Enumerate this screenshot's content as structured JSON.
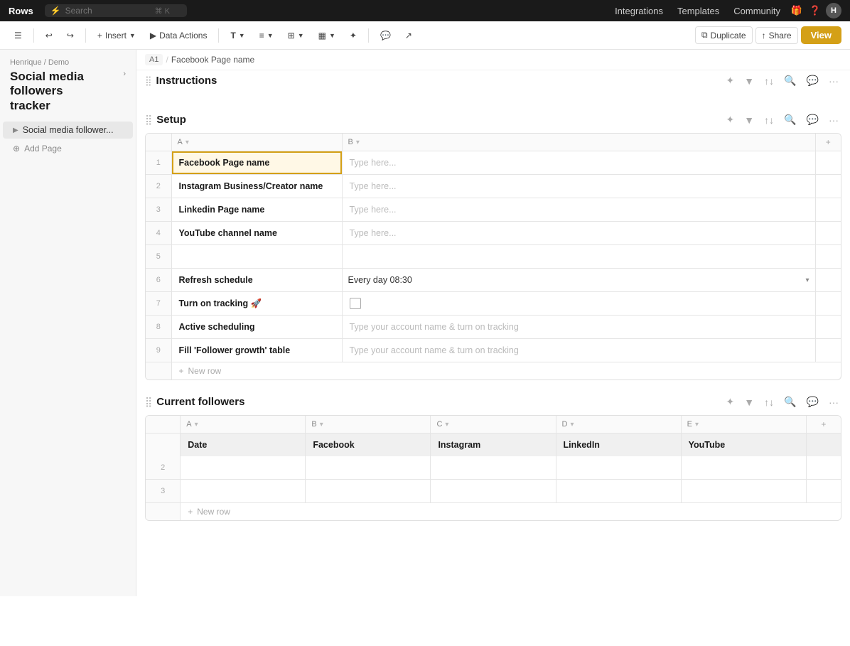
{
  "app": {
    "logo": "Rows",
    "search_placeholder": "Search",
    "search_kbd": "⌘ K"
  },
  "top_nav": {
    "integrations": "Integrations",
    "templates": "Templates",
    "community": "Community",
    "avatar_initials": "H"
  },
  "toolbar": {
    "sidebar_toggle": "☰",
    "undo": "↩",
    "redo": "↪",
    "insert": "Insert",
    "data_actions": "Data Actions",
    "text_format": "T",
    "align": "≡",
    "grid": "⊞",
    "chart": "📊",
    "brush": "✦",
    "comment": "💬",
    "stats": "📈",
    "duplicate": "Duplicate",
    "share": "Share",
    "view": "View"
  },
  "sidebar": {
    "breadcrumb_part1": "Henrique",
    "breadcrumb_sep": "/",
    "breadcrumb_part2": "Demo",
    "title_line1": "Social media",
    "title_line2": "followers",
    "title_line3": "tracker",
    "page_item": "Social media follower...",
    "add_page": "Add Page"
  },
  "breadcrumb_bar": {
    "cell": "A1",
    "sep": "/",
    "path": "Facebook Page name"
  },
  "instructions_section": {
    "title": "Instructions",
    "icons": [
      "✦",
      "▼",
      "↑↓",
      "🔍",
      "💬",
      "···"
    ]
  },
  "setup_section": {
    "title": "Setup",
    "icons": [
      "✦",
      "▼",
      "↑↓",
      "🔍",
      "💬",
      "···"
    ],
    "col_a_header": "A",
    "col_b_header": "B",
    "rows": [
      {
        "num": "1",
        "col_a": "Facebook Page name",
        "col_b": "",
        "col_b_placeholder": "Type here...",
        "type": "input",
        "selected": true
      },
      {
        "num": "2",
        "col_a": "Instagram Business/Creator name",
        "col_b": "",
        "col_b_placeholder": "Type here...",
        "type": "input"
      },
      {
        "num": "3",
        "col_a": "Linkedin Page name",
        "col_b": "",
        "col_b_placeholder": "Type here...",
        "type": "input"
      },
      {
        "num": "4",
        "col_a": "YouTube channel name",
        "col_b": "",
        "col_b_placeholder": "Type here...",
        "type": "input"
      },
      {
        "num": "5",
        "col_a": "",
        "col_b": "",
        "type": "empty"
      },
      {
        "num": "6",
        "col_a": "Refresh schedule",
        "col_b": "Every day 08:30",
        "type": "dropdown"
      },
      {
        "num": "7",
        "col_a": "Turn on tracking 🚀",
        "col_b": "",
        "type": "checkbox"
      },
      {
        "num": "8",
        "col_a": "Active scheduling",
        "col_b": "Type your account name & turn on tracking",
        "type": "text"
      },
      {
        "num": "9",
        "col_a": "Fill 'Follower growth' table",
        "col_b": "Type your account name & turn on tracking",
        "type": "text"
      }
    ],
    "new_row": "+ New row"
  },
  "current_followers_section": {
    "title": "Current followers",
    "icons": [
      "✦",
      "▼",
      "↑↓",
      "🔍",
      "💬",
      "···"
    ],
    "columns": [
      {
        "letter": "A",
        "name": "Date"
      },
      {
        "letter": "B",
        "name": "Facebook"
      },
      {
        "letter": "C",
        "name": "Instagram"
      },
      {
        "letter": "D",
        "name": "LinkedIn"
      },
      {
        "letter": "E",
        "name": "YouTube"
      }
    ],
    "rows": [
      "2",
      "3"
    ],
    "new_row": "+ New row"
  }
}
